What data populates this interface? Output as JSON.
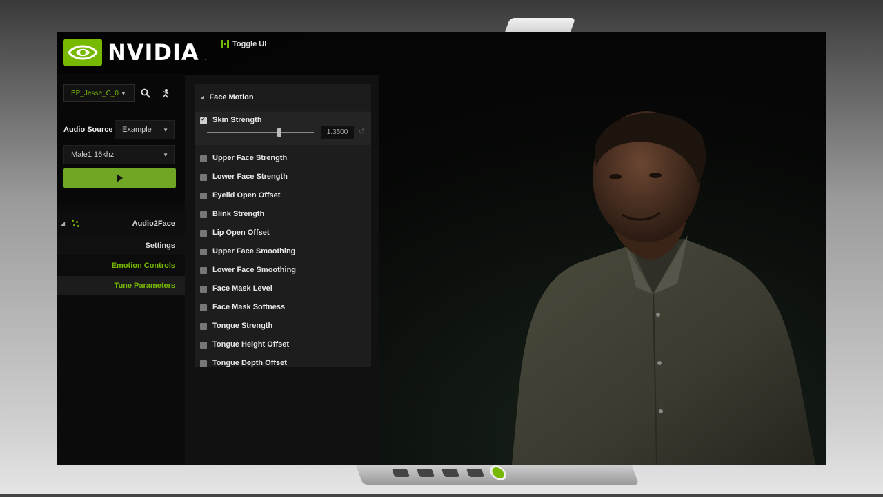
{
  "brand": {
    "name": "NVIDIA",
    "accent": "#76b900"
  },
  "toolbar": {
    "toggle_ui_label": "Toggle UI"
  },
  "left_panel": {
    "blueprint_selector": "BP_Jesse_C_0",
    "audio_source_label": "Audio Source",
    "audio_source_value": "Example",
    "audio_file_value": "Male1 16khz",
    "plugin_name": "Audio2Face",
    "nav": [
      {
        "label": "Settings"
      },
      {
        "label": "Emotion Controls"
      },
      {
        "label": "Tune Parameters"
      }
    ]
  },
  "face_motion": {
    "header": "Face Motion",
    "skin_strength": {
      "label": "Skin Strength",
      "value": "1.3500",
      "checked": true,
      "slider_fraction": 0.68
    },
    "params": [
      {
        "label": "Upper Face Strength"
      },
      {
        "label": "Lower Face Strength"
      },
      {
        "label": "Eyelid Open Offset"
      },
      {
        "label": "Blink Strength"
      },
      {
        "label": "Lip Open Offset"
      },
      {
        "label": "Upper Face Smoothing"
      },
      {
        "label": "Lower Face Smoothing"
      },
      {
        "label": "Face Mask Level"
      },
      {
        "label": "Face Mask Softness"
      },
      {
        "label": "Tongue Strength"
      },
      {
        "label": "Tongue Height Offset"
      },
      {
        "label": "Tongue Depth Offset"
      }
    ]
  }
}
